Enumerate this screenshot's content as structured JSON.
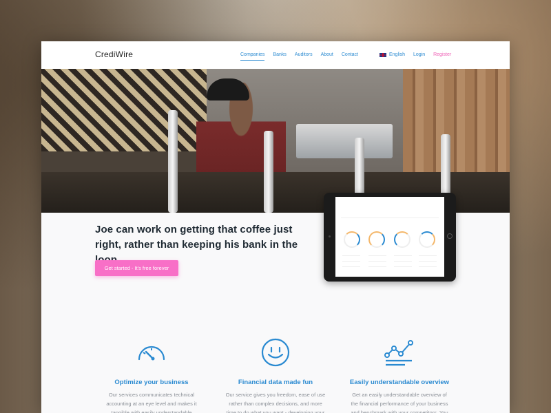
{
  "brand": {
    "name": "CrediWire"
  },
  "nav": {
    "items": [
      {
        "label": "Companies",
        "active": true
      },
      {
        "label": "Banks",
        "active": false
      },
      {
        "label": "Auditors",
        "active": false
      },
      {
        "label": "About",
        "active": false
      },
      {
        "label": "Contact",
        "active": false
      }
    ],
    "language": "English",
    "login": "Login",
    "register": "Register"
  },
  "intro": {
    "headline": "Joe can work on getting that coffee just right, rather than keeping his bank in the loop.",
    "cta": "Get started - It's free forever"
  },
  "features": [
    {
      "icon": "speedometer-icon",
      "title": "Optimize your business",
      "text": "Our services communicates technical accounting at an eye level and makes it tangible with easily understandable"
    },
    {
      "icon": "smiley-icon",
      "title": "Financial data made fun",
      "text": "Our service gives you freedom, ease of use rather than complex decisions, and more time to do what you want - developing your"
    },
    {
      "icon": "line-chart-icon",
      "title": "Easily understandable overview",
      "text": "Get an easily understandable overview of the financial performance of your business and benchmark with your competitors. You decide"
    }
  ],
  "colors": {
    "accent": "#2a8ad1",
    "cta": "#f86fc7",
    "register": "#ef5fb5",
    "headline": "#1f2a33",
    "body_text": "#8a8f96"
  }
}
